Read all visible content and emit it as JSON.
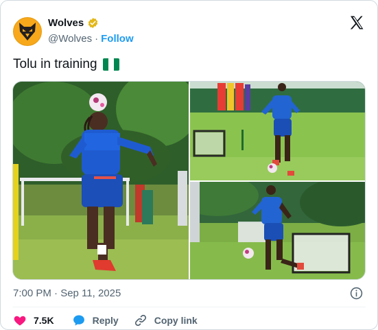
{
  "account": {
    "display_name": "Wolves",
    "handle": "@Wolves",
    "separator": "·",
    "follow_label": "Follow"
  },
  "tweet": {
    "text": "Tolu in training",
    "flag": "Nigeria"
  },
  "timestamp": "7:00 PM · Sep 11, 2025",
  "actions": {
    "like_count": "7.5K",
    "reply_label": "Reply",
    "copy_link_label": "Copy link"
  },
  "colors": {
    "brand_gold": "#f7a81b",
    "link_blue": "#1d9bf0",
    "like_pink": "#f91880",
    "muted": "#536471",
    "flag_green": "#008751"
  },
  "icons": [
    "wolves-logo-icon",
    "verified-badge-icon",
    "x-logo-icon",
    "nigeria-flag-icon",
    "info-icon",
    "heart-icon",
    "reply-icon",
    "link-icon"
  ]
}
